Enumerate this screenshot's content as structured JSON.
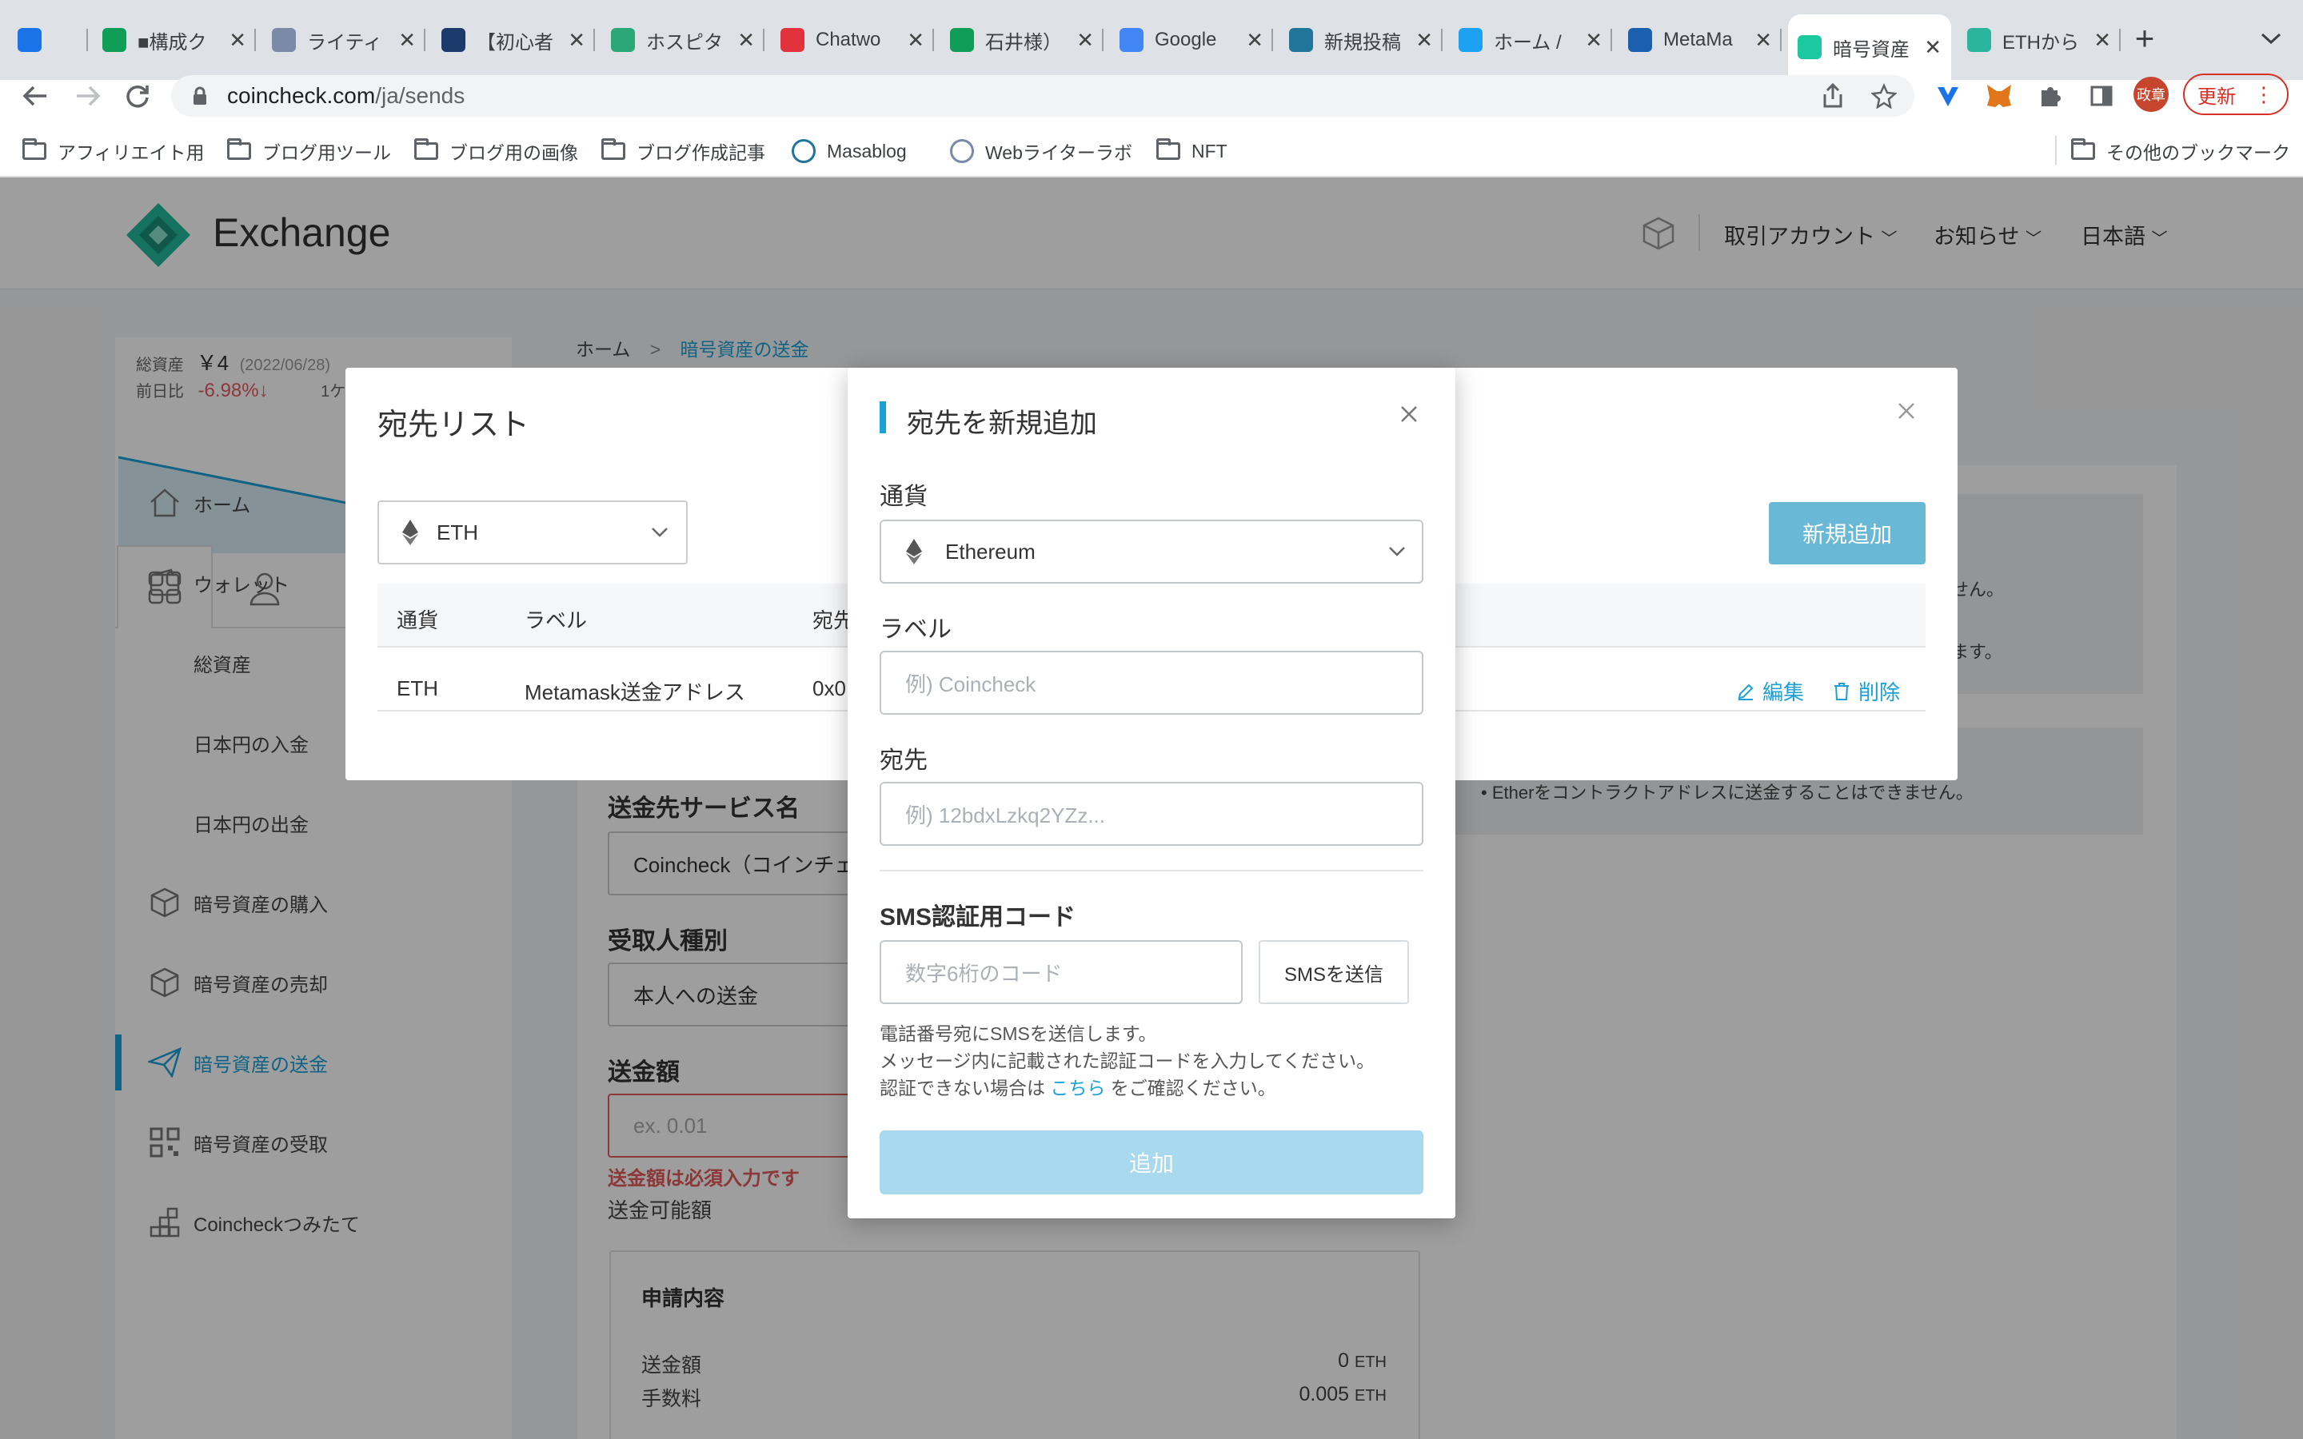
{
  "browser": {
    "tabs": [
      {
        "title": "",
        "icon": "vpn-icon",
        "color": "#1a73e8"
      },
      {
        "title": "■構成ク",
        "icon": "sheets-icon",
        "color": "#0f9d58"
      },
      {
        "title": "ライティ",
        "icon": "pen-icon",
        "color": "#7a8aa8"
      },
      {
        "title": "【初心者",
        "icon": "l-icon",
        "color": "#1c3a6b"
      },
      {
        "title": "ホスピタ",
        "icon": "flower-icon",
        "color": "#2aa876"
      },
      {
        "title": "Chatwo",
        "icon": "chatwork-icon",
        "color": "#e2323c"
      },
      {
        "title": "石井様）",
        "icon": "sheets-icon",
        "color": "#0f9d58"
      },
      {
        "title": "Google",
        "icon": "docs-icon",
        "color": "#4285f4"
      },
      {
        "title": "新規投稿",
        "icon": "wordpress-icon",
        "color": "#21759b"
      },
      {
        "title": "ホーム /",
        "icon": "twitter-icon",
        "color": "#1da1f2"
      },
      {
        "title": "MetaMa",
        "icon": "metamask-alpha-icon",
        "color": "#1b5fb0"
      },
      {
        "title": "暗号資産",
        "icon": "coincheck-icon",
        "color": "#1bc8a0",
        "active": true
      },
      {
        "title": "ETHから",
        "icon": "c-icon",
        "color": "#2bb59e"
      }
    ],
    "new_tab": "+",
    "url": "coincheck.com/ja/sends",
    "url_host": "coincheck.com",
    "url_path": "/ja/sends",
    "profile_initials": "政章",
    "update_label": "更新",
    "bookmarks": [
      {
        "label": "アフィリエイト用",
        "icon": "folder-icon"
      },
      {
        "label": "ブログ用ツール",
        "icon": "folder-icon"
      },
      {
        "label": "ブログ用の画像",
        "icon": "folder-icon"
      },
      {
        "label": "ブログ作成記事",
        "icon": "folder-icon"
      },
      {
        "label": "Masablog",
        "icon": "wordpress-icon"
      },
      {
        "label": "Webライターラボ",
        "icon": "pen-icon"
      },
      {
        "label": "NFT",
        "icon": "folder-icon"
      }
    ],
    "other_bookmarks": "その他のブックマーク"
  },
  "site": {
    "logo": "Exchange",
    "nav": [
      "取引アカウント",
      "お知らせ",
      "日本語"
    ],
    "breadcrumb": {
      "home": "ホーム",
      "sep": ">",
      "current": "暗号資産の送金"
    },
    "assets": {
      "label": "総資産",
      "value": "￥4",
      "date": "(2022/06/28)",
      "change_label": "前日比",
      "change_value": "-6.98%↓",
      "period": "1ケ"
    },
    "sidebar": [
      {
        "label": "ホーム",
        "icon": "home-icon"
      },
      {
        "label": "ウォレット",
        "icon": "wallet-icon"
      },
      {
        "label": "総資産",
        "icon": ""
      },
      {
        "label": "日本円の入金",
        "icon": ""
      },
      {
        "label": "日本円の出金",
        "icon": ""
      },
      {
        "label": "暗号資産の購入",
        "icon": "cube-icon"
      },
      {
        "label": "暗号資産の売却",
        "icon": "cube-icon"
      },
      {
        "label": "暗号資産の送金",
        "icon": "send-icon",
        "active": true
      },
      {
        "label": "暗号資産の受取",
        "icon": "qr-icon"
      },
      {
        "label": "Coincheckつみたて",
        "icon": "blocks-icon"
      }
    ],
    "form": {
      "service_label": "送金先サービス名",
      "service_value": "Coincheck（コインチェ",
      "recipient_label": "受取人種別",
      "recipient_value": "本人への送金",
      "amount_label": "送金額",
      "amount_placeholder": "ex. 0.01",
      "amount_error": "送金額は必須入力です",
      "available_label": "送金可能額",
      "summary_title": "申請内容",
      "summary_rows": [
        {
          "label": "送金額",
          "value": "0",
          "unit": "ETH"
        },
        {
          "label": "手数料",
          "value": "0.005",
          "unit": "ETH"
        }
      ]
    },
    "notices": [
      "せん。",
      "ます。",
      "Etherをコントラクトアドレスに送金することはできません。"
    ]
  },
  "list_modal": {
    "title": "宛先リスト",
    "currency_select": "ETH",
    "new_button": "新規追加",
    "columns": [
      "通貨",
      "ラベル",
      "宛先"
    ],
    "columns_visible": [
      "通貨",
      "ラベル",
      "宛先"
    ],
    "rows": [
      {
        "currency": "ETH",
        "label": "Metamask送金アドレス",
        "address": "0x0",
        "edit": "編集",
        "delete": "削除"
      }
    ]
  },
  "new_modal": {
    "title": "宛先を新規追加",
    "currency_label": "通貨",
    "currency_value": "Ethereum",
    "label_label": "ラベル",
    "label_placeholder": "例) Coincheck",
    "address_label": "宛先",
    "address_placeholder": "例) 12bdxLzkq2YZz...",
    "sms_label": "SMS認証用コード",
    "sms_placeholder": "数字6桁のコード",
    "sms_button": "SMSを送信",
    "help_line1": "電話番号宛にSMSを送信します。",
    "help_line2": "メッセージ内に記載された認証コードを入力してください。",
    "help_line3_pre": "認証できない場合は",
    "help_line3_link": "こちら",
    "help_line3_post": "をご確認ください。",
    "submit": "追加"
  },
  "colors": {
    "accent": "#1ba1d6",
    "brand_green": "#23b99a",
    "error": "#e35b5b",
    "submit_disabled": "#a9d9ee"
  }
}
